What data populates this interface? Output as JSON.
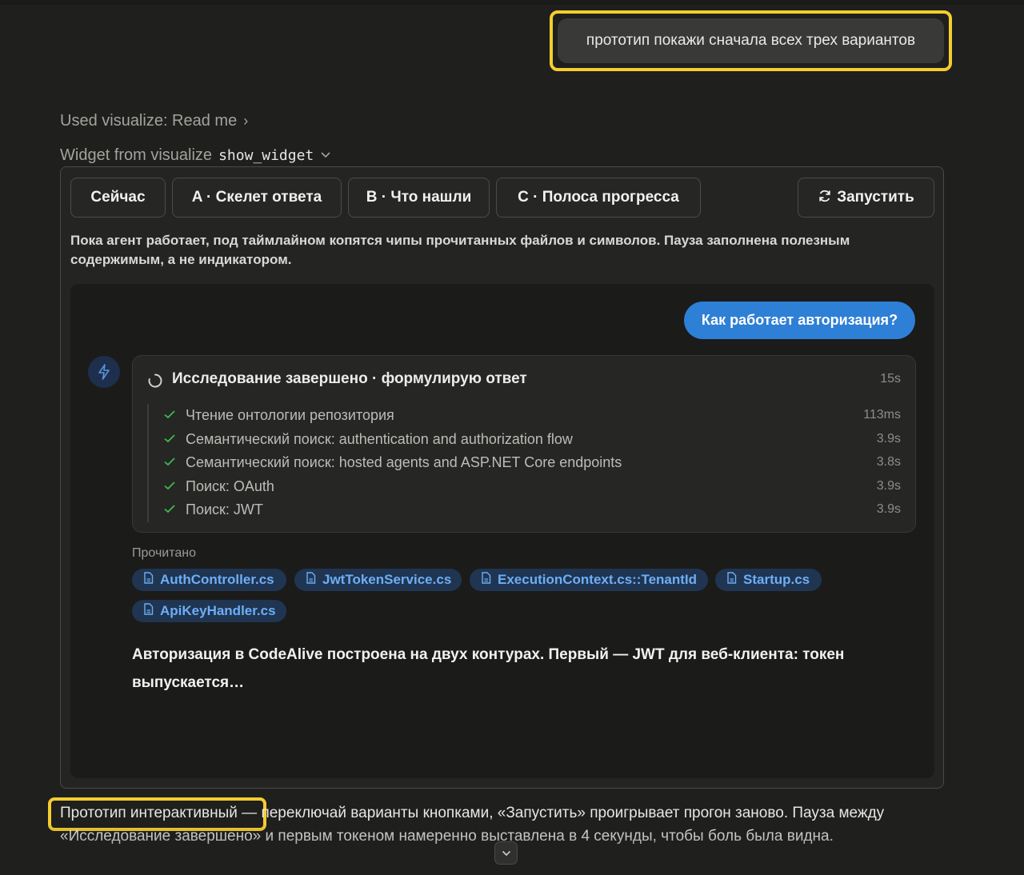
{
  "user_message": "прототип покажи сначала всех трех вариантов",
  "tool_used": {
    "label": "Used visualize: Read me"
  },
  "widget_header": {
    "prefix": "Widget from visualize",
    "code": "show_widget"
  },
  "tabs": [
    {
      "label": "Сейчас"
    },
    {
      "label": "A · Скелет ответа"
    },
    {
      "label": "B · Что нашли"
    },
    {
      "label": "C · Полоса прогресса"
    }
  ],
  "run_button": {
    "label": "Запустить",
    "icon": "refresh-icon"
  },
  "description": "Пока агент работает, под таймлайном копятся чипы прочитанных файлов и символов. Пауза заполнена полезным содержимым, а не индикатором.",
  "preview": {
    "question": "Как работает авторизация?",
    "research": {
      "title": "Исследование завершено · формулирую ответ",
      "time": "15s",
      "steps": [
        {
          "text": "Чтение онтологии репозитория",
          "duration": "113ms"
        },
        {
          "text": "Семантический поиск: authentication and authorization flow",
          "duration": "3.9s"
        },
        {
          "text": "Семантический поиск: hosted agents and ASP.NET Core endpoints",
          "duration": "3.8s"
        },
        {
          "text": "Поиск: OAuth",
          "duration": "3.9s"
        },
        {
          "text": "Поиск: JWT",
          "duration": "3.9s"
        }
      ]
    },
    "read_label": "Прочитано",
    "files": [
      "AuthController.cs",
      "JwtTokenService.cs",
      "ExecutionContext.cs::TenantId",
      "Startup.cs",
      "ApiKeyHandler.cs"
    ],
    "answer": "Авторизация в CodeAlive построена на двух контурах. Первый — JWT для веб-клиента: токен выпускается…"
  },
  "bottom": {
    "highlight": "Прототип интерактивный",
    "rest": " — переключай варианты кнопками, «Запустить» проигрывает прогон заново. Пауза между «Исследование завершено» и первым токеном намеренно выставлена в 4 секунды, чтобы боль была видна."
  },
  "colors": {
    "accent": "#2e7fd6",
    "highlight": "#f5cd2e",
    "success": "#3fb950",
    "chip_bg": "#1f3552",
    "chip_text": "#6eaef5"
  }
}
